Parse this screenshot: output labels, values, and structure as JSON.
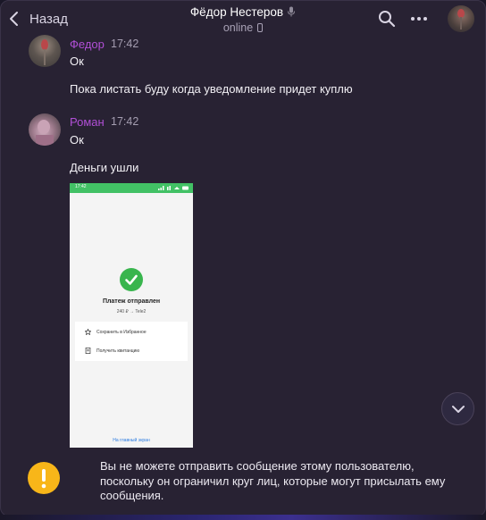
{
  "header": {
    "back_label": "Назад",
    "chat_title": "Фёдор Нестеров",
    "status": "online"
  },
  "messages": [
    {
      "sender": "Федор",
      "time": "17:42",
      "lines": [
        "Ок",
        "Пока листать буду когда уведомление придет куплю"
      ]
    },
    {
      "sender": "Роман",
      "time": "17:42",
      "lines": [
        "Ок",
        "Деньги ушли"
      ]
    }
  ],
  "photo": {
    "status_time": "17:42",
    "title": "Платеж отправлен",
    "subtitle": "240 ₽ → Tele2",
    "actions": [
      "Сохранить в Избранное",
      "Получить квитанцию"
    ],
    "link": "На главный экран",
    "accent": "#42c165"
  },
  "notice": {
    "text": "Вы не можете отправить сообщение этому пользователю, поскольку он ограничил круг лиц, которые могут присылать ему сообщения."
  },
  "colors": {
    "background": "#282233",
    "sender_name": "#b04fd6",
    "warning": "#f8b619"
  },
  "icons": [
    "chevron-left-icon",
    "microphone-icon",
    "phone-icon",
    "search-icon",
    "more-icon",
    "chevron-down-icon",
    "exclamation-icon",
    "check-icon",
    "star-icon",
    "receipt-icon"
  ]
}
